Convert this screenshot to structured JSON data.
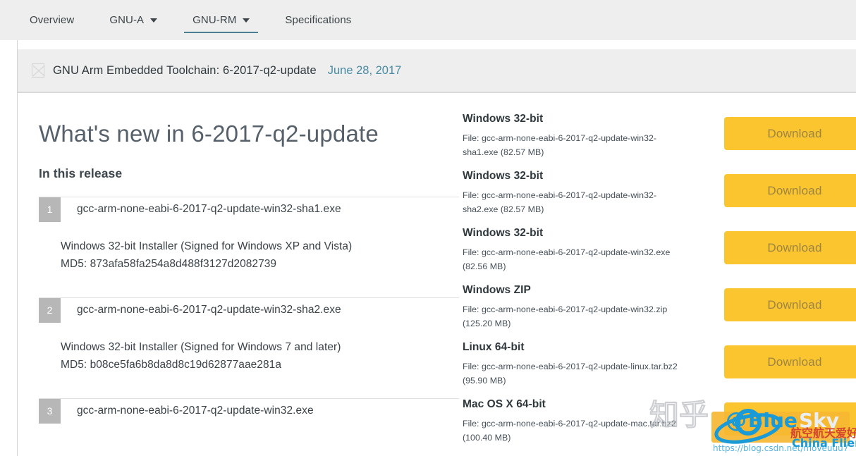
{
  "nav": {
    "items": [
      {
        "label": "Overview",
        "has_caret": false,
        "active": false
      },
      {
        "label": "GNU-A",
        "has_caret": true,
        "active": false
      },
      {
        "label": "GNU-RM",
        "has_caret": true,
        "active": true
      },
      {
        "label": "Specifications",
        "has_caret": false,
        "active": false
      }
    ]
  },
  "release": {
    "icon": "broken-image-icon",
    "title": "GNU Arm Embedded Toolchain: 6-2017-q2-update",
    "date": "June 28, 2017"
  },
  "main": {
    "heading": "What's new in 6-2017-q2-update",
    "subheading": "In this release",
    "files": [
      {
        "number": "1",
        "name": "gcc-arm-none-eabi-6-2017-q2-update-win32-sha1.exe",
        "desc_line1": "Windows 32-bit Installer (Signed for Windows XP and Vista)",
        "desc_line2": "MD5: 873afa58fa254a8d488f3127d2082739"
      },
      {
        "number": "2",
        "name": "gcc-arm-none-eabi-6-2017-q2-update-win32-sha2.exe",
        "desc_line1": "Windows 32-bit Installer (Signed for Windows 7 and later)",
        "desc_line2": "MD5: b08ce5fa6b8da8d8c19d62877aae281a"
      },
      {
        "number": "3",
        "name": "gcc-arm-none-eabi-6-2017-q2-update-win32.exe",
        "desc_line1": "",
        "desc_line2": ""
      }
    ]
  },
  "downloads": {
    "button_label": "Download",
    "button_color": "#fac52f",
    "items": [
      {
        "title": "Windows 32-bit",
        "file": "File: gcc-arm-none-eabi-6-2017-q2-update-win32-sha1.exe (82.57 MB)"
      },
      {
        "title": "Windows 32-bit",
        "file": "File: gcc-arm-none-eabi-6-2017-q2-update-win32-sha2.exe (82.57 MB)"
      },
      {
        "title": "Windows 32-bit",
        "file": "File: gcc-arm-none-eabi-6-2017-q2-update-win32.exe (82.56 MB)"
      },
      {
        "title": "Windows ZIP",
        "file": "File: gcc-arm-none-eabi-6-2017-q2-update-win32.zip (125.20 MB)"
      },
      {
        "title": "Linux 64-bit",
        "file": "File: gcc-arm-none-eabi-6-2017-q2-update-linux.tar.bz2 (95.90 MB)"
      },
      {
        "title": "Mac OS X 64-bit",
        "file": "File: gcc-arm-none-eabi-6-2017-q2-update-mac.tar.bz2 (100.40 MB)"
      }
    ]
  },
  "watermarks": {
    "zhihu": "知乎",
    "bluesky_at": "@",
    "bluesky_blue": "Blue",
    "bluesky_sky": "Sky",
    "bluesky_cn": "航空航天爱好者联盟",
    "bluesky_en": "China Flier",
    "bluesky_url": "https://blog.csdn.net/moveuuu7"
  },
  "theme": {
    "nav_bg": "#eeeeee",
    "band_bg": "#eeeeee",
    "accent_underline": "#4c7f92",
    "link_color": "#4a8ba3",
    "button_bg": "#fac52f",
    "button_text": "#9d8441",
    "number_badge_bg": "#b7b7b7"
  }
}
